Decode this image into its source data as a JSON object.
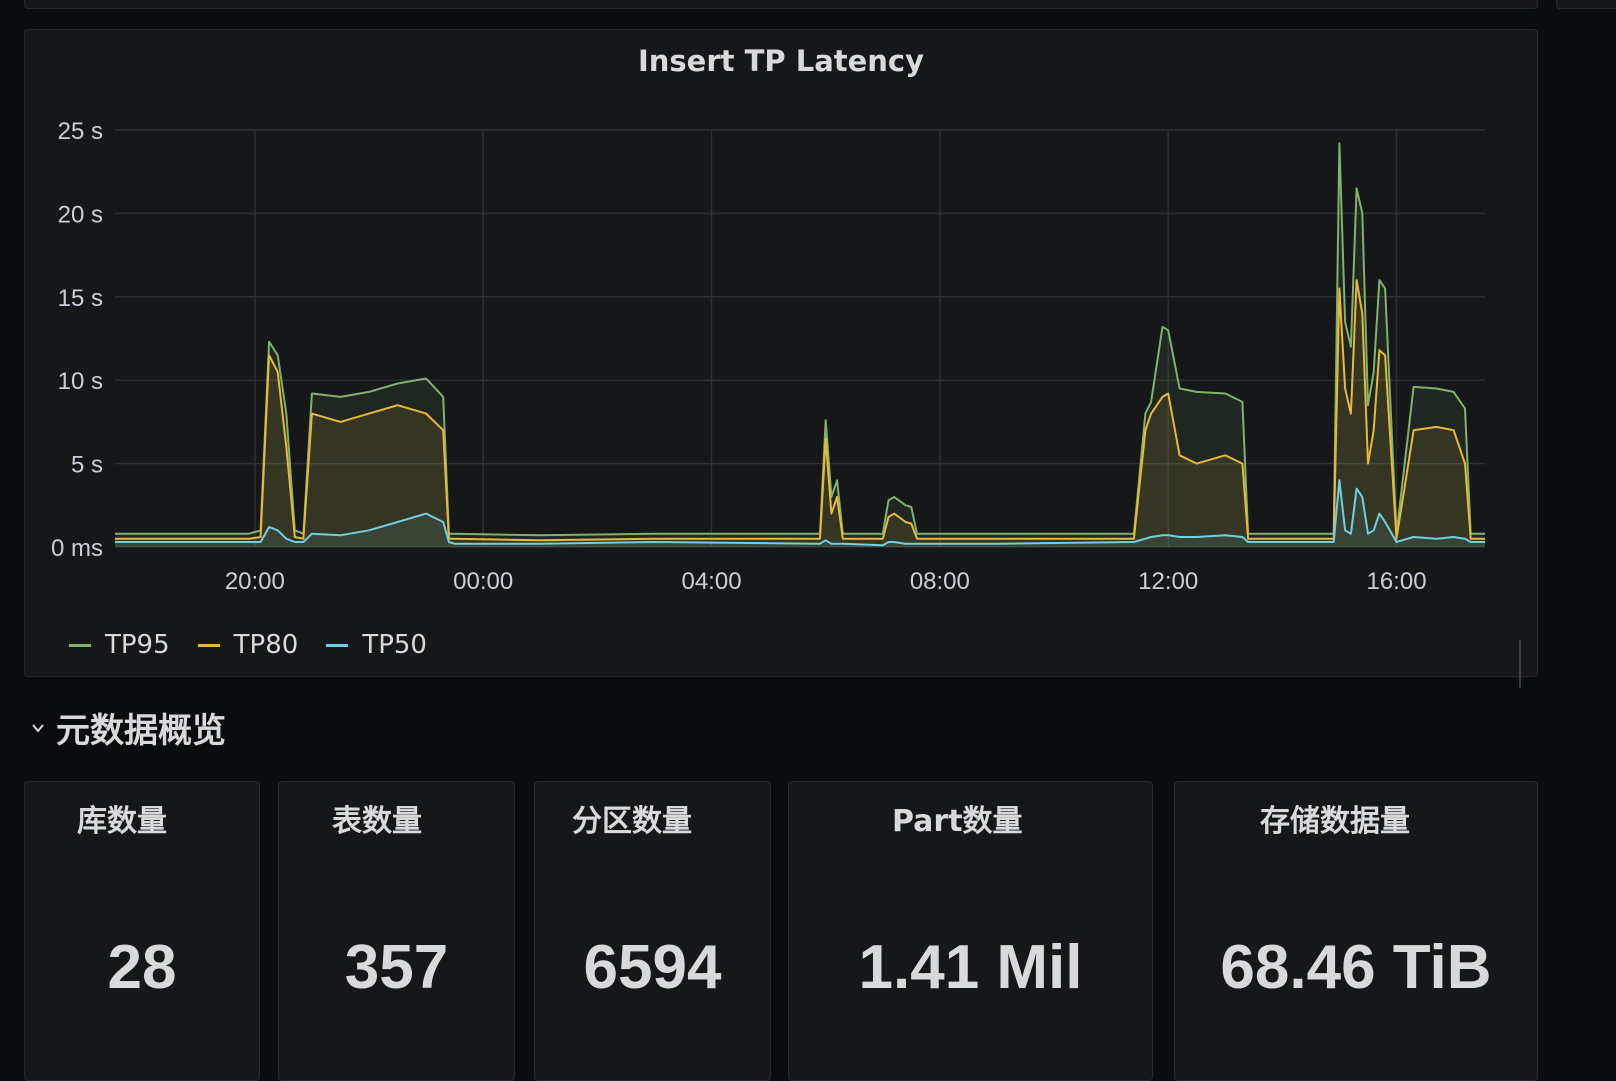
{
  "chart": {
    "title": "Insert TP Latency",
    "legend": [
      {
        "name": "TP95",
        "color": "#7eb26d"
      },
      {
        "name": "TP80",
        "color": "#eab839"
      },
      {
        "name": "TP50",
        "color": "#6ed0e0"
      }
    ]
  },
  "chart_data": {
    "type": "line",
    "title": "Insert TP Latency",
    "y_unit": "s",
    "ylim": [
      0,
      25
    ],
    "y_ticks": [
      "0 ms",
      "5 s",
      "10 s",
      "15 s",
      "20 s",
      "25 s"
    ],
    "x_ticks": [
      "20:00",
      "00:00",
      "04:00",
      "08:00",
      "12:00",
      "16:00"
    ],
    "x_range_hours": [
      17.55,
      41.55
    ],
    "grid": true,
    "legend_position": "bottom-left",
    "series": [
      {
        "name": "TP95",
        "color": "#7eb26d",
        "x": [
          17.55,
          19.9,
          20.1,
          20.25,
          20.4,
          20.55,
          20.7,
          20.85,
          21.0,
          21.5,
          22.0,
          22.5,
          23.0,
          23.3,
          23.4,
          23.5,
          25.0,
          27.0,
          29.9,
          30.0,
          30.1,
          30.2,
          30.3,
          31.0,
          31.1,
          31.2,
          31.4,
          31.5,
          31.6,
          33.0,
          35.4,
          35.6,
          35.7,
          35.9,
          36.0,
          36.2,
          36.5,
          37.0,
          37.3,
          37.4,
          37.5,
          38.0,
          38.9,
          39.0,
          39.1,
          39.2,
          39.3,
          39.4,
          39.5,
          39.6,
          39.7,
          39.8,
          40.0,
          40.3,
          40.7,
          41.0,
          41.2,
          41.3,
          41.55
        ],
        "y": [
          0.8,
          0.8,
          1.0,
          12.3,
          11.5,
          8.0,
          1.0,
          0.8,
          9.2,
          9.0,
          9.3,
          9.8,
          10.1,
          9.0,
          0.8,
          0.8,
          0.7,
          0.8,
          0.8,
          7.6,
          3.0,
          4.0,
          0.8,
          0.8,
          2.8,
          3.0,
          2.5,
          2.4,
          0.8,
          0.8,
          0.8,
          8.0,
          8.7,
          13.2,
          13.0,
          9.5,
          9.3,
          9.2,
          8.7,
          0.8,
          0.8,
          0.8,
          0.8,
          24.2,
          13.5,
          12.0,
          21.5,
          20.0,
          8.5,
          10.5,
          16.0,
          15.5,
          0.8,
          9.6,
          9.5,
          9.3,
          8.3,
          0.8,
          0.8
        ]
      },
      {
        "name": "TP80",
        "color": "#eab839",
        "x": [
          17.55,
          19.9,
          20.1,
          20.25,
          20.4,
          20.55,
          20.7,
          20.85,
          21.0,
          21.5,
          22.0,
          22.5,
          23.0,
          23.3,
          23.4,
          23.5,
          25.0,
          27.0,
          29.9,
          30.0,
          30.1,
          30.2,
          30.3,
          31.0,
          31.1,
          31.2,
          31.4,
          31.5,
          31.6,
          33.0,
          35.4,
          35.6,
          35.7,
          35.9,
          36.0,
          36.2,
          36.5,
          37.0,
          37.3,
          37.4,
          37.5,
          38.0,
          38.9,
          39.0,
          39.1,
          39.2,
          39.3,
          39.4,
          39.5,
          39.6,
          39.7,
          39.8,
          40.0,
          40.3,
          40.7,
          41.0,
          41.2,
          41.3,
          41.55
        ],
        "y": [
          0.5,
          0.5,
          0.6,
          11.5,
          10.5,
          6.0,
          0.6,
          0.5,
          8.0,
          7.5,
          8.0,
          8.5,
          8.0,
          7.0,
          0.5,
          0.5,
          0.4,
          0.5,
          0.5,
          6.5,
          2.0,
          3.0,
          0.5,
          0.5,
          1.8,
          2.0,
          1.5,
          1.4,
          0.5,
          0.5,
          0.5,
          7.0,
          8.0,
          9.0,
          9.2,
          5.5,
          5.0,
          5.5,
          5.0,
          0.5,
          0.5,
          0.5,
          0.5,
          15.5,
          9.5,
          8.0,
          16.0,
          14.0,
          5.0,
          7.0,
          11.8,
          11.5,
          0.5,
          7.0,
          7.2,
          7.0,
          5.0,
          0.5,
          0.5
        ]
      },
      {
        "name": "TP50",
        "color": "#6ed0e0",
        "x": [
          17.55,
          19.9,
          20.1,
          20.25,
          20.4,
          20.55,
          20.7,
          20.85,
          21.0,
          21.5,
          22.0,
          22.5,
          23.0,
          23.3,
          23.4,
          23.5,
          25.0,
          27.0,
          29.9,
          30.0,
          30.1,
          30.2,
          30.3,
          31.0,
          31.1,
          31.2,
          31.4,
          31.5,
          31.6,
          33.0,
          35.4,
          35.6,
          35.7,
          35.9,
          36.0,
          36.2,
          36.5,
          37.0,
          37.3,
          37.4,
          37.5,
          38.0,
          38.9,
          39.0,
          39.1,
          39.2,
          39.3,
          39.4,
          39.5,
          39.6,
          39.7,
          39.8,
          40.0,
          40.3,
          40.7,
          41.0,
          41.2,
          41.3,
          41.55
        ],
        "y": [
          0.3,
          0.3,
          0.3,
          1.2,
          1.0,
          0.5,
          0.3,
          0.3,
          0.8,
          0.7,
          1.0,
          1.5,
          2.0,
          1.5,
          0.3,
          0.2,
          0.2,
          0.3,
          0.2,
          0.4,
          0.2,
          0.2,
          0.2,
          0.1,
          0.3,
          0.3,
          0.2,
          0.2,
          0.2,
          0.2,
          0.3,
          0.5,
          0.6,
          0.7,
          0.7,
          0.6,
          0.6,
          0.7,
          0.6,
          0.3,
          0.3,
          0.3,
          0.3,
          4.0,
          1.0,
          0.8,
          3.5,
          3.0,
          0.8,
          1.0,
          2.0,
          1.5,
          0.3,
          0.6,
          0.5,
          0.6,
          0.5,
          0.3,
          0.3
        ]
      }
    ]
  },
  "row": {
    "title": "元数据概览"
  },
  "stats": [
    {
      "title": "库数量",
      "value": "28"
    },
    {
      "title": "表数量",
      "value": "357"
    },
    {
      "title": "分区数量",
      "value": "6594"
    },
    {
      "title": "Part数量",
      "value": "1.41 Mil"
    },
    {
      "title": "存储数据量",
      "value": "68.46 TiB"
    }
  ]
}
